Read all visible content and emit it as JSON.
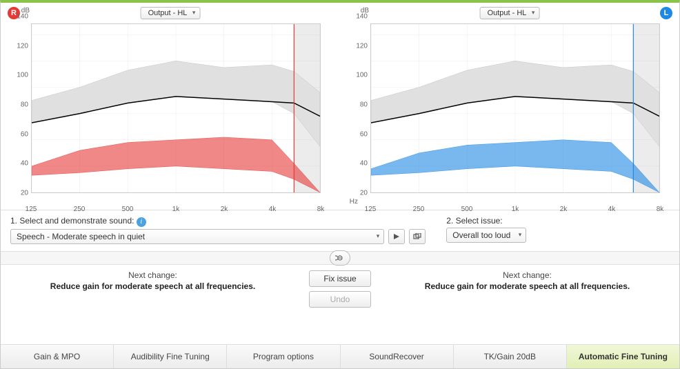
{
  "ears": {
    "right": {
      "badge": "R",
      "color": "#e53935",
      "dropdown": "Output - HL"
    },
    "left": {
      "badge": "L",
      "color": "#1e88e5",
      "dropdown": "Output - HL"
    }
  },
  "chart": {
    "y_unit": "dB",
    "x_unit": "Hz",
    "y_ticks": [
      20,
      40,
      60,
      80,
      100,
      120,
      140
    ],
    "x_ticks": [
      "125",
      "250",
      "500",
      "1k",
      "2k",
      "4k",
      "8k"
    ]
  },
  "chart_data": [
    {
      "side": "right",
      "type": "area",
      "x": [
        125,
        250,
        500,
        1000,
        2000,
        4000,
        5500,
        8000
      ],
      "ylim": [
        20,
        148
      ],
      "xlim": [
        125,
        8000
      ],
      "marker_x": 5500,
      "series": [
        {
          "name": "mpo_upper_gray",
          "fill": "#e0e0e0",
          "stroke": "#bbb",
          "high": [
            90,
            100,
            113,
            120,
            115,
            117,
            112,
            96
          ],
          "low": [
            73,
            80,
            88,
            93,
            91,
            89,
            80,
            55
          ]
        },
        {
          "name": "target_black_line",
          "stroke": "#000",
          "values": [
            73,
            80,
            88,
            93,
            91,
            89,
            88,
            78
          ]
        },
        {
          "name": "speech_area",
          "fill": "rgba(229,57,53,0.6)",
          "stroke": "#e53935",
          "high": [
            40,
            52,
            58,
            60,
            62,
            60,
            42,
            20
          ],
          "low": [
            33,
            35,
            38,
            40,
            38,
            36,
            30,
            20
          ]
        }
      ]
    },
    {
      "side": "left",
      "type": "area",
      "x": [
        125,
        250,
        500,
        1000,
        2000,
        4000,
        5500,
        8000
      ],
      "ylim": [
        20,
        148
      ],
      "xlim": [
        125,
        8000
      ],
      "marker_x": 5500,
      "series": [
        {
          "name": "mpo_upper_gray",
          "fill": "#e0e0e0",
          "stroke": "#bbb",
          "high": [
            90,
            100,
            113,
            120,
            115,
            117,
            112,
            96
          ],
          "low": [
            73,
            80,
            88,
            93,
            91,
            89,
            80,
            55
          ]
        },
        {
          "name": "target_black_line",
          "stroke": "#000",
          "values": [
            73,
            80,
            88,
            93,
            91,
            89,
            88,
            78
          ]
        },
        {
          "name": "speech_area",
          "fill": "rgba(30,136,229,0.6)",
          "stroke": "#1e88e5",
          "high": [
            38,
            50,
            56,
            58,
            60,
            58,
            42,
            20
          ],
          "low": [
            33,
            35,
            38,
            40,
            38,
            36,
            30,
            20
          ]
        }
      ]
    }
  ],
  "controls": {
    "step1_label": "1. Select and demonstrate sound:",
    "sound_value": "Speech - Moderate speech in quiet",
    "step2_label": "2. Select issue:",
    "issue_value": "Overall too loud"
  },
  "actions": {
    "next_title": "Next change:",
    "next_desc": "Reduce gain for moderate speech at all frequencies.",
    "fix_label": "Fix issue",
    "undo_label": "Undo"
  },
  "tabs": [
    {
      "label": "Gain & MPO",
      "active": false
    },
    {
      "label": "Audibility Fine Tuning",
      "active": false
    },
    {
      "label": "Program options",
      "active": false
    },
    {
      "label": "SoundRecover",
      "active": false
    },
    {
      "label": "TK/Gain 20dB",
      "active": false
    },
    {
      "label": "Automatic Fine Tuning",
      "active": true
    }
  ]
}
